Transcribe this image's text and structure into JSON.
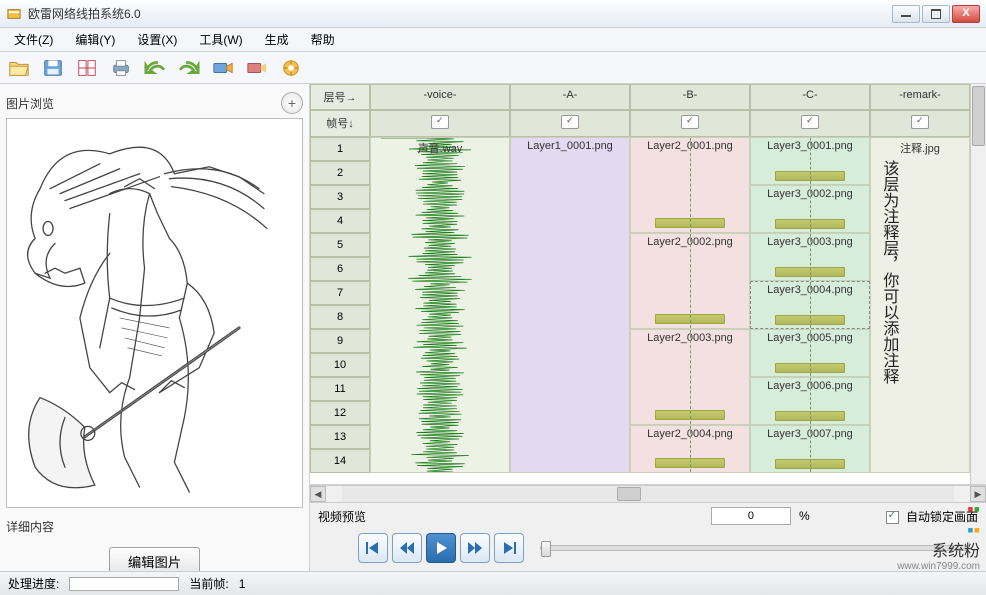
{
  "window": {
    "title": "欧雷网络线拍系统6.0"
  },
  "menu": {
    "file": "文件(Z)",
    "edit": "编辑(Y)",
    "settings": "设置(X)",
    "tools": "工具(W)",
    "generate": "生成",
    "help": "帮助"
  },
  "left": {
    "preview_label": "图片浏览",
    "detail_label": "详细内容",
    "edit_button": "编辑图片"
  },
  "timeline": {
    "layer_header": "层号→",
    "frame_header": "帧号↓",
    "columns": [
      "-voice-",
      "-A-",
      "-B-",
      "-C-",
      "-remark-"
    ],
    "rows": [
      1,
      2,
      3,
      4,
      5,
      6,
      7,
      8,
      9,
      10,
      11,
      12,
      13,
      14
    ],
    "voice_label": "声音.wav",
    "col_a": {
      "1": "Layer1_0001.png"
    },
    "col_b": {
      "1": "Layer2_0001.png",
      "5": "Layer2_0002.png",
      "9": "Layer2_0003.png",
      "13": "Layer2_0004.png"
    },
    "col_c": {
      "1": "Layer3_0001.png",
      "3": "Layer3_0002.png",
      "5": "Layer3_0003.png",
      "7": "Layer3_0004.png",
      "9": "Layer3_0005.png",
      "11": "Layer3_0006.png",
      "13": "Layer3_0007.png"
    },
    "remark_filename": "注释.jpg",
    "remark_text": "该层为注释层，你可以添加注释"
  },
  "preview_bar": {
    "label": "视频预览",
    "percent_value": "0",
    "percent_sign": "%",
    "lock_label": "自动锁定画面",
    "lock_checked": true
  },
  "status": {
    "progress_label": "处理进度:",
    "frame_label": "当前帧:",
    "frame_value": "1"
  },
  "watermark": {
    "brand": "系统粉",
    "url": "www.win7999.com"
  }
}
